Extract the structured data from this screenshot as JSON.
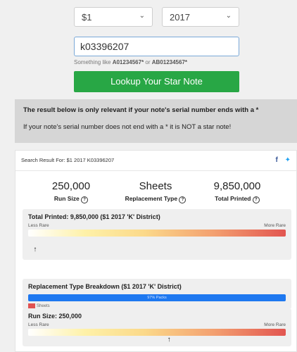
{
  "form": {
    "amount_value": "$1",
    "year_value": "2017",
    "serial_value": "k03396207",
    "hint_prefix": "Something like ",
    "hint_ex1": "A01234567*",
    "hint_mid": " or ",
    "hint_ex2": "AB01234567*",
    "lookup_label": "Lookup Your Star Note"
  },
  "notice": {
    "line1": "The result below is only relevant if your note's serial number ends with a *",
    "line2": "If your note's serial number does not end with a * it is NOT a star note!"
  },
  "result": {
    "header": "Search Result For: $1 2017 K03396207",
    "stats": [
      {
        "value": "250,000",
        "label": "Run Size"
      },
      {
        "value": "Sheets",
        "label": "Replacement Type"
      },
      {
        "value": "9,850,000",
        "label": "Total Printed"
      }
    ],
    "total_printed_card": {
      "title": "Total Printed: 9,850,000 ($1 2017 'K' District)",
      "less_rare": "Less Rare",
      "more_rare": "More Rare",
      "marker_position": 0.02
    },
    "breakdown_card": {
      "title": "Replacement Type Breakdown ($1 2017 'K' District)",
      "bar_label": "97% Packs",
      "legend_label": "Sheets"
    },
    "run_size_card": {
      "title": "Run Size: 250,000",
      "less_rare": "Less Rare",
      "more_rare": "More Rare",
      "marker_position": 0.54
    }
  },
  "colors": {
    "lookup_button": "#28a745",
    "packs_bar": "#1e78f0",
    "sheets_legend": "#e05252"
  },
  "icons": [
    "chevron-down-icon",
    "question-icon",
    "facebook-icon",
    "twitter-icon",
    "up-arrow-icon"
  ]
}
